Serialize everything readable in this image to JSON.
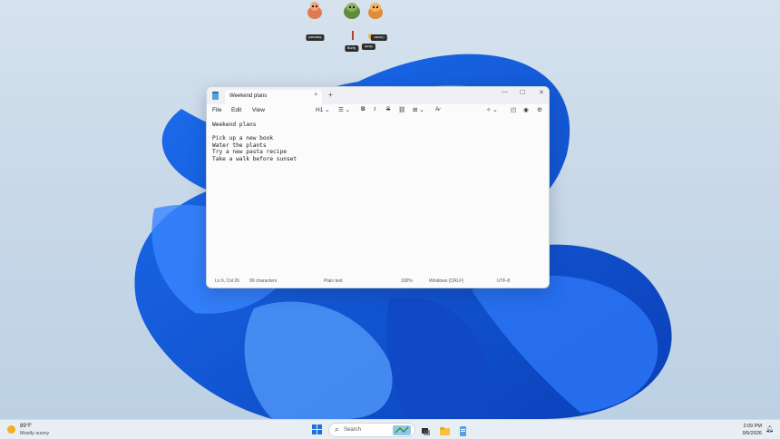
{
  "pets": {
    "labels": [
      "Maxwell",
      "Sprig",
      "Moth",
      "Cinder"
    ]
  },
  "notepad": {
    "tab_title": "Weekend plans",
    "tab_close": "×",
    "new_tab": "+",
    "window_controls": {
      "minimize": "—",
      "maximize": "☐",
      "close": "✕"
    },
    "menu": {
      "file": "File",
      "edit": "Edit",
      "view": "View"
    },
    "toolbar": {
      "heading": "H1",
      "bold": "B",
      "italic": "I",
      "strike": "S"
    },
    "content_lines": [
      "Weekend plans",
      "",
      "Pick up a new book",
      "Water the plants",
      "Try a new pasta recipe",
      "Take a walk before sunset"
    ],
    "status": {
      "position": "Ln 6, Col 26",
      "characters": "99 characters",
      "format": "Plain text",
      "zoom": "100%",
      "line_endings": "Windows (CRLF)",
      "encoding": "UTF-8"
    }
  },
  "taskbar": {
    "weather_temp": "89°F",
    "weather_condition": "Mostly sunny",
    "search_placeholder": "Search",
    "time": "2:09 PM",
    "date": "9/5/2026"
  }
}
